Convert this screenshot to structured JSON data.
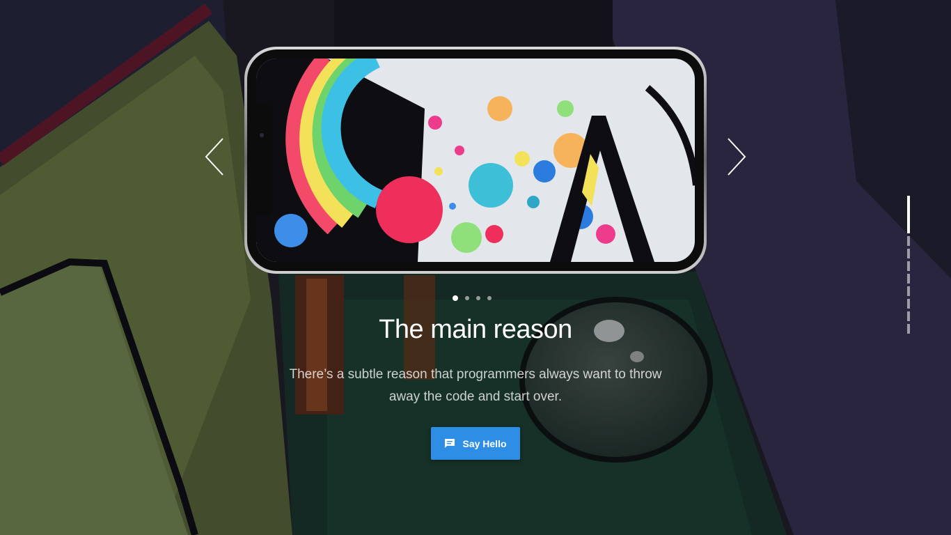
{
  "slider": {
    "slides_count": 4,
    "active_slide": 1,
    "prev_icon": "chevron-left-icon",
    "next_icon": "chevron-right-icon"
  },
  "hero": {
    "title": "The main reason",
    "description": "There’s a subtle reason that programmers always want to throw away the code and start over.",
    "cta_label": "Say Hello",
    "cta_icon": "chat-bubble-icon"
  },
  "side_pager": {
    "sections_count": 6,
    "active_section": 1
  },
  "colors": {
    "accent": "#2e8ee6",
    "text": "#ffffff",
    "background": "#1a1824"
  }
}
